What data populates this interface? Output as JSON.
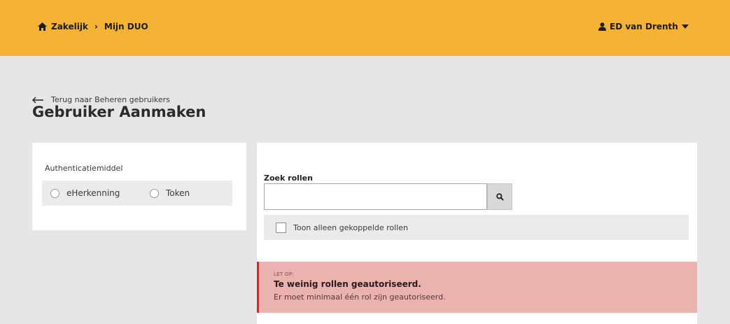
{
  "header": {
    "breadcrumb": {
      "home": "Zakelijk",
      "separator": "›",
      "current": "Mijn DUO"
    },
    "user_name": "ED van Drenth"
  },
  "back_link": "Terug naar Beheren gebruikers",
  "page_title": "Gebruiker Aanmaken",
  "auth": {
    "label": "Authenticatiemiddel",
    "options": [
      "eHerkenning",
      "Token"
    ]
  },
  "roles": {
    "search_label": "Zoek rollen",
    "search_value": "",
    "filter_label": "Toon alleen gekoppelde rollen"
  },
  "alert": {
    "tag": "LET OP:",
    "title": "Te weinig rollen geautoriseerd.",
    "message": "Er moet minimaal één rol zijn geautoriseerd."
  },
  "colors": {
    "header": "#f5b335",
    "alert_bg": "#eab3b0",
    "alert_border": "#d52b1e"
  }
}
